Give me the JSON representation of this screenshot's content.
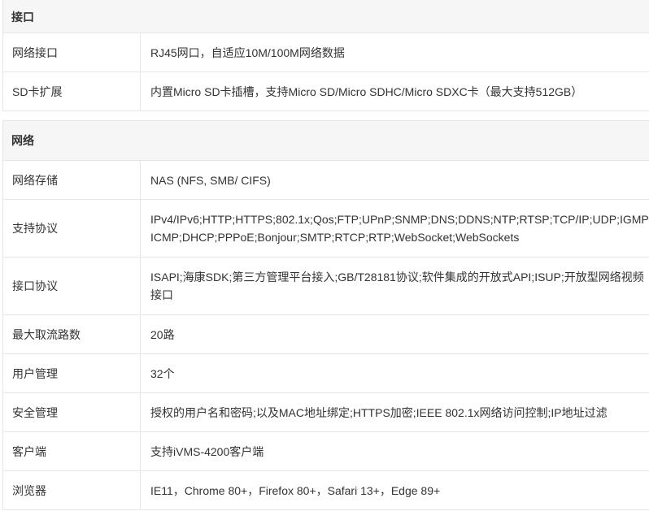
{
  "sections": [
    {
      "title": "接口",
      "rows": [
        {
          "label": "网络接口",
          "value": "RJ45网口，自适应10M/100M网络数据"
        },
        {
          "label": "SD卡扩展",
          "value": "内置Micro SD卡插槽，支持Micro SD/Micro SDHC/Micro SDXC卡（最大支持512GB）"
        }
      ]
    },
    {
      "title": "网络",
      "rows": [
        {
          "label": "网络存储",
          "value": "NAS (NFS, SMB/ CIFS)"
        },
        {
          "label": "支持协议",
          "value": "IPv4/IPv6;HTTP;HTTPS;802.1x;Qos;FTP;UPnP;SNMP;DNS;DDNS;NTP;RTSP;TCP/IP;UDP;IGMP;\nICMP;DHCP;PPPoE;Bonjour;SMTP;RTCP;RTP;WebSocket;WebSockets"
        },
        {
          "label": "接口协议",
          "value": "ISAPI;海康SDK;第三方管理平台接入;GB/T28181协议;软件集成的开放式API;ISUP;开放型网络视频\n接口"
        },
        {
          "label": "最大取流路数",
          "value": "20路"
        },
        {
          "label": "用户管理",
          "value": "32个"
        },
        {
          "label": "安全管理",
          "value": "授权的用户名和密码;以及MAC地址绑定;HTTPS加密;IEEE 802.1x网络访问控制;IP地址过滤"
        },
        {
          "label": "客户端",
          "value": "支持iVMS-4200客户端"
        },
        {
          "label": "浏览器",
          "value": "IE11，Chrome 80+，Firefox 80+，Safari 13+，Edge 89+"
        }
      ]
    }
  ]
}
